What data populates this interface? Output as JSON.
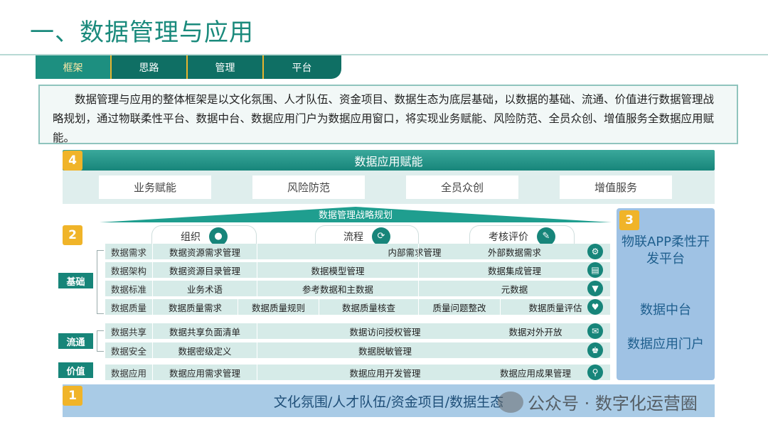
{
  "title": "一、数据管理与应用",
  "tabs": [
    {
      "label": "框架",
      "active": true
    },
    {
      "label": "思路",
      "active": false
    },
    {
      "label": "管理",
      "active": false
    },
    {
      "label": "平台",
      "active": false
    }
  ],
  "intro": "数据管理与应用的整体框架是以文化氛围、人才队伍、资金项目、数据生态为底层基础，以数据的基础、流通、价值进行数据管理战略规划，通过物联柔性平台、数据中台、数据应用门户为数据应用窗口，将实现业务赋能、风险防范、全员众创、增值服务全数据应用赋能。",
  "layer4": {
    "badge": "4",
    "title": "数据应用赋能",
    "items": [
      "业务赋能",
      "风险防范",
      "全员众创",
      "增值服务"
    ]
  },
  "layer2": {
    "badge": "2",
    "strategy": "数据管理战略规划",
    "headers": [
      "组织",
      "流程",
      "考核评价"
    ],
    "groups": [
      "基础",
      "流通",
      "价值"
    ],
    "rows": [
      {
        "cat": "数据需求",
        "cells": [
          "数据资源需求管理",
          "内部需求管理",
          "外部数据需求"
        ],
        "icon": "gear-icon"
      },
      {
        "cat": "数据架构",
        "cells": [
          "数据资源目录管理",
          "数据模型管理",
          "数据集成管理"
        ],
        "icon": "clipboard-icon"
      },
      {
        "cat": "数据标准",
        "cells": [
          "业务术语",
          "参考数据和主数据",
          "元数据"
        ],
        "icon": "filter-icon"
      },
      {
        "cat": "数据质量",
        "cells": [
          "数据质量需求",
          "数据质量规则",
          "数据质量核查",
          "质量问题整改",
          "数据质量评估"
        ],
        "icon": "shield-icon"
      },
      {
        "cat": "数据共享",
        "cells": [
          "数据共享负面清单",
          "数据访问授权管理",
          "数据对外开放"
        ],
        "icon": "chat-icon"
      },
      {
        "cat": "数据安全",
        "cells": [
          "数据密级定义",
          "数据脱敏管理"
        ],
        "icon": "people-icon"
      },
      {
        "cat": "数据应用",
        "cells": [
          "数据应用需求管理",
          "数据应用开发管理",
          "数据应用成果管理"
        ],
        "icon": "search-icon"
      }
    ]
  },
  "layer3": {
    "badge": "3",
    "items": [
      "物联APP柔性开发平台",
      "数据中台",
      "数据应用门户"
    ]
  },
  "layer1": {
    "badge": "1",
    "text": "文化氛围/人才队伍/资金项目/数据生态"
  },
  "watermark": "公众号 · 数字化运营圈"
}
